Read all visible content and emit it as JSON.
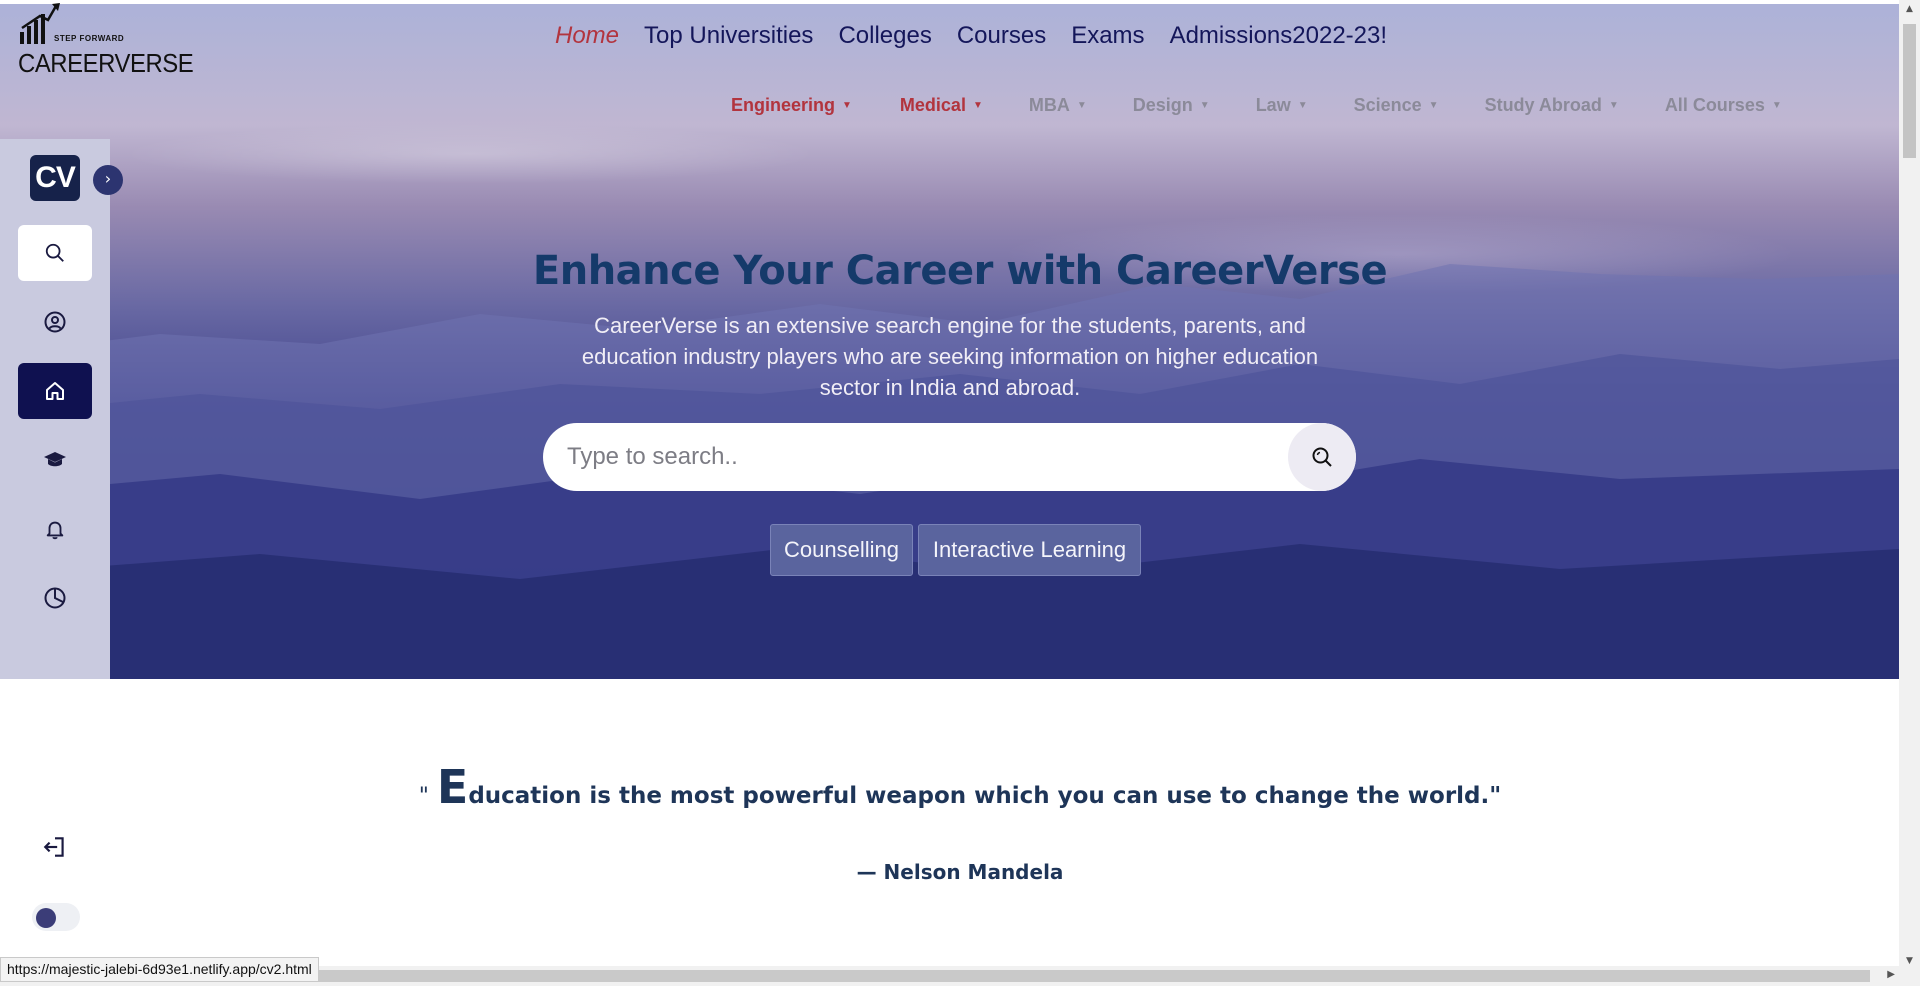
{
  "brand": {
    "tagline": "STEP FORWARD",
    "wordmark": "CAREERVERSE",
    "mini_logo": "CV"
  },
  "topnav": {
    "items": [
      "Home",
      "Top Universities",
      "Colleges",
      "Courses",
      "Exams",
      "Admissions"
    ],
    "suffix": "2022-23!",
    "active": "Home"
  },
  "subnav": [
    {
      "label": "Engineering",
      "state": "active"
    },
    {
      "label": "Medical",
      "state": "active"
    },
    {
      "label": "MBA",
      "state": "muted"
    },
    {
      "label": "Design",
      "state": "muted"
    },
    {
      "label": "Law",
      "state": "muted"
    },
    {
      "label": "Science",
      "state": "muted"
    },
    {
      "label": "Study Abroad",
      "state": "muted"
    },
    {
      "label": "All Courses",
      "state": "muted"
    }
  ],
  "sidebar": {
    "icons": [
      "search-icon",
      "user-circle-icon",
      "home-icon",
      "graduation-cap-icon",
      "bell-icon",
      "pie-chart-icon"
    ],
    "active": "home-icon",
    "footer_icons": [
      "logout-icon",
      "theme-toggle"
    ]
  },
  "hero": {
    "title": "Enhance Your Career with CareerVerse",
    "description": "CareerVerse is an extensive search engine for the students, parents, and education industry players who are seeking information on higher education sector in India and abroad.",
    "search_placeholder": "Type to search..",
    "chips": [
      "Counselling",
      "Interactive Learning"
    ]
  },
  "quote": {
    "open": "\"",
    "first_letter": "E",
    "rest": "ducation is the most powerful weapon which you can use to change the world.\"",
    "author": "— Nelson Mandela"
  },
  "status_url": "https://majestic-jalebi-6d93e1.netlify.app/cv2.html",
  "colors": {
    "accent_red": "#b2343e",
    "nav_dark": "#14165a",
    "title_blue": "#153a6a",
    "sidebar_active": "#0f1150"
  }
}
